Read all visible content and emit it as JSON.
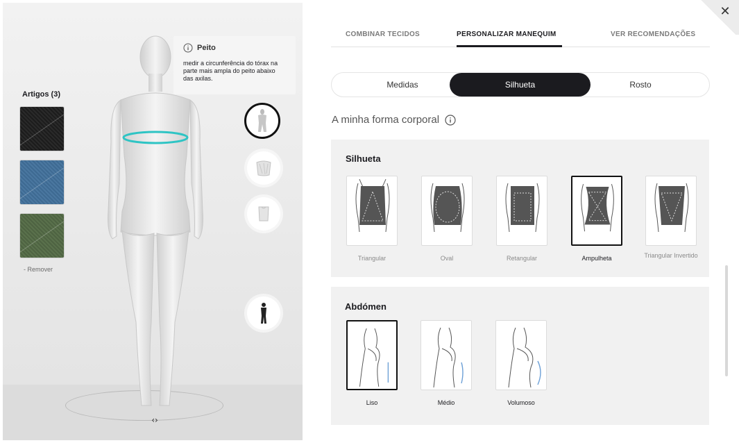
{
  "articles": {
    "title": "Artigos (3)",
    "swatches": [
      "fabric-black",
      "fabric-blue",
      "fabric-green"
    ],
    "remove_label": "- Remover"
  },
  "tooltip": {
    "title": "Peito",
    "text": "medir a circunferência do tórax na parte mais ampla do peito abaixo das axilas."
  },
  "viewer": {
    "rotate_glyph": "‹›"
  },
  "close_glyph": "✕",
  "tabs": [
    {
      "label": "COMBINAR TECIDOS",
      "active": false
    },
    {
      "label": "PERSONALIZAR MANEQUIM",
      "active": true
    },
    {
      "label": "VER RECOMENDAÇÕES",
      "active": false
    }
  ],
  "segments": [
    {
      "label": "Medidas",
      "active": false
    },
    {
      "label": "Silhueta",
      "active": true
    },
    {
      "label": "Rosto",
      "active": false
    }
  ],
  "body_shape": {
    "title": "A minha forma corporal"
  },
  "silhouette": {
    "title": "Silhueta",
    "options": [
      {
        "label": "Triangular",
        "selected": false
      },
      {
        "label": "Oval",
        "selected": false
      },
      {
        "label": "Retangular",
        "selected": false
      },
      {
        "label": "Ampulheta",
        "selected": true
      },
      {
        "label": "Triangular Invertido",
        "selected": false
      }
    ]
  },
  "abdomen": {
    "title": "Abdómen",
    "options": [
      {
        "label": "Liso",
        "selected": true
      },
      {
        "label": "Médio",
        "selected": false
      },
      {
        "label": "Volumoso",
        "selected": false
      }
    ]
  },
  "colors": {
    "accent": "#1b1b1f",
    "measure_line": "#2ec4c4",
    "torso_dark": "#555555"
  }
}
